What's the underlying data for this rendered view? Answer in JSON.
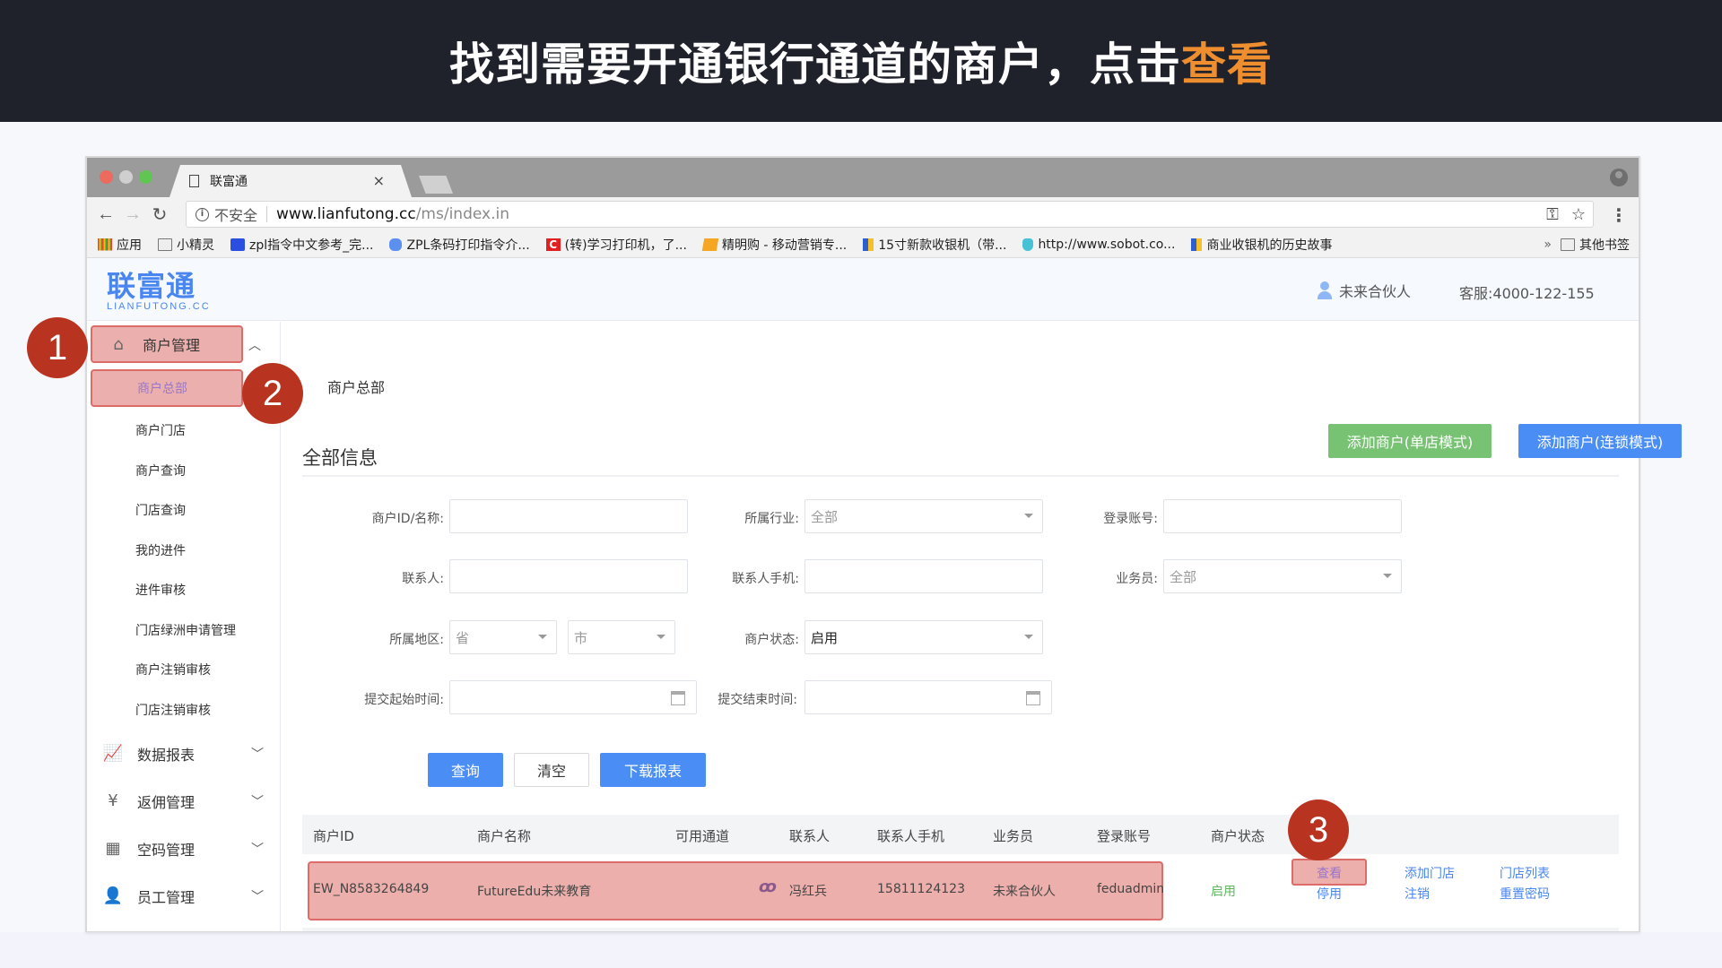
{
  "banner": {
    "title_main": "找到需要开通银行通道的商户，点击",
    "title_highlight": "查看"
  },
  "browser": {
    "tab_title": "联富通",
    "tab_close": "×",
    "address": {
      "security_label": "不安全",
      "host": "www.lianfutong.cc",
      "path": "/ms/index.in"
    },
    "bookmarks": [
      {
        "icon": "apps-icon",
        "label": "应用"
      },
      {
        "icon": "folder-icon",
        "label": "小精灵"
      },
      {
        "icon": "baidu-paw-icon",
        "label": "zpl指令中文参考_完..."
      },
      {
        "icon": "baidu-paw-icon",
        "label": "ZPL条码打印指令介..."
      },
      {
        "icon": "c-icon",
        "label": "(转)学习打印机，了..."
      },
      {
        "icon": "shopping-icon",
        "label": "精明购 - 移动营销专..."
      },
      {
        "icon": "j-icon",
        "label": "15寸新款收银机（带..."
      },
      {
        "icon": "tooth-icon",
        "label": "http://www.sobot.co..."
      },
      {
        "icon": "j-icon",
        "label": "商业收银机的历史故事"
      }
    ],
    "bookmarks_overflow": "»",
    "other_bookmarks": "其他书签"
  },
  "app": {
    "logo_text": "联富通",
    "logo_sub": "LIANFUTONG.CC",
    "user_name": "未来合伙人",
    "service": "客服:4000-122-155",
    "sidebar": {
      "groups": [
        {
          "icon": "home-icon",
          "label": "商户管理",
          "expanded": true
        },
        {
          "icon": "chart-monitor-icon",
          "label": "数据报表",
          "expanded": false
        },
        {
          "icon": "yen-calendar-icon",
          "label": "返佣管理",
          "expanded": false
        },
        {
          "icon": "qrcode-icon",
          "label": "空码管理",
          "expanded": false
        },
        {
          "icon": "person-icon",
          "label": "员工管理",
          "expanded": false
        }
      ],
      "sub_items": [
        "商户总部",
        "商户门店",
        "商户查询",
        "门店查询",
        "我的进件",
        "进件审核",
        "门店绿洲申请管理",
        "商户注销审核",
        "门店注销审核"
      ],
      "active_sub": "商户总部"
    },
    "breadcrumb": "商户总部",
    "section_title": "全部信息",
    "add_single_btn": "添加商户(单店模式)",
    "add_chain_btn": "添加商户(连锁模式)",
    "filters": {
      "merchant_id_label": "商户ID/名称:",
      "merchant_id_value": "",
      "industry_label": "所属行业:",
      "industry_value": "全部",
      "login_label": "登录账号:",
      "login_value": "",
      "contact_label": "联系人:",
      "contact_value": "",
      "contact_phone_label": "联系人手机:",
      "contact_phone_value": "",
      "salesman_label": "业务员:",
      "salesman_value": "全部",
      "region_label": "所属地区:",
      "province_value": "省",
      "city_value": "市",
      "status_label": "商户状态:",
      "status_value": "启用",
      "start_time_label": "提交起始时间:",
      "start_time_value": "",
      "end_time_label": "提交结束时间:",
      "end_time_value": ""
    },
    "buttons": {
      "query": "查询",
      "clear": "清空",
      "download": "下载报表"
    },
    "table": {
      "headers": [
        "商户ID",
        "商户名称",
        "可用通道",
        "联系人",
        "联系人手机",
        "业务员",
        "登录账号",
        "商户状态"
      ],
      "rows": [
        {
          "merchant_id": "EW_N8583264849",
          "merchant_name": "FutureEdu未来教育",
          "channel_icon": "channel-logo-icon",
          "contact": "冯红兵",
          "phone": "15811124123",
          "salesman": "未来合伙人",
          "login": "feduadmin",
          "status": "启用",
          "actions": [
            "查看",
            "停用",
            "添加门店",
            "注销",
            "门店列表",
            "重置密码"
          ]
        }
      ]
    }
  },
  "steps": [
    "1",
    "2",
    "3"
  ],
  "colors": {
    "banner_bg": "#1f222b",
    "banner_highlight": "#ee8e2f",
    "highlight_fill": "#ebb0ae",
    "highlight_border": "#dc6c67",
    "step_badge": "#b83420",
    "primary_blue": "#4a8ef5",
    "green": "#78c373",
    "link": "#4a86f0"
  }
}
